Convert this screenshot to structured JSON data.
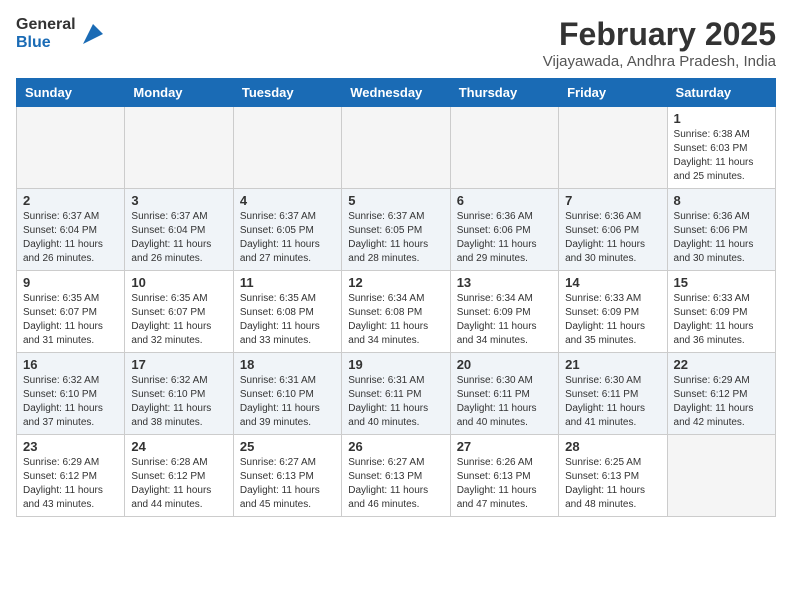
{
  "header": {
    "logo_general": "General",
    "logo_blue": "Blue",
    "month_year": "February 2025",
    "location": "Vijayawada, Andhra Pradesh, India"
  },
  "weekdays": [
    "Sunday",
    "Monday",
    "Tuesday",
    "Wednesday",
    "Thursday",
    "Friday",
    "Saturday"
  ],
  "weeks": [
    [
      {
        "day": "",
        "info": ""
      },
      {
        "day": "",
        "info": ""
      },
      {
        "day": "",
        "info": ""
      },
      {
        "day": "",
        "info": ""
      },
      {
        "day": "",
        "info": ""
      },
      {
        "day": "",
        "info": ""
      },
      {
        "day": "1",
        "info": "Sunrise: 6:38 AM\nSunset: 6:03 PM\nDaylight: 11 hours\nand 25 minutes."
      }
    ],
    [
      {
        "day": "2",
        "info": "Sunrise: 6:37 AM\nSunset: 6:04 PM\nDaylight: 11 hours\nand 26 minutes."
      },
      {
        "day": "3",
        "info": "Sunrise: 6:37 AM\nSunset: 6:04 PM\nDaylight: 11 hours\nand 26 minutes."
      },
      {
        "day": "4",
        "info": "Sunrise: 6:37 AM\nSunset: 6:05 PM\nDaylight: 11 hours\nand 27 minutes."
      },
      {
        "day": "5",
        "info": "Sunrise: 6:37 AM\nSunset: 6:05 PM\nDaylight: 11 hours\nand 28 minutes."
      },
      {
        "day": "6",
        "info": "Sunrise: 6:36 AM\nSunset: 6:06 PM\nDaylight: 11 hours\nand 29 minutes."
      },
      {
        "day": "7",
        "info": "Sunrise: 6:36 AM\nSunset: 6:06 PM\nDaylight: 11 hours\nand 30 minutes."
      },
      {
        "day": "8",
        "info": "Sunrise: 6:36 AM\nSunset: 6:06 PM\nDaylight: 11 hours\nand 30 minutes."
      }
    ],
    [
      {
        "day": "9",
        "info": "Sunrise: 6:35 AM\nSunset: 6:07 PM\nDaylight: 11 hours\nand 31 minutes."
      },
      {
        "day": "10",
        "info": "Sunrise: 6:35 AM\nSunset: 6:07 PM\nDaylight: 11 hours\nand 32 minutes."
      },
      {
        "day": "11",
        "info": "Sunrise: 6:35 AM\nSunset: 6:08 PM\nDaylight: 11 hours\nand 33 minutes."
      },
      {
        "day": "12",
        "info": "Sunrise: 6:34 AM\nSunset: 6:08 PM\nDaylight: 11 hours\nand 34 minutes."
      },
      {
        "day": "13",
        "info": "Sunrise: 6:34 AM\nSunset: 6:09 PM\nDaylight: 11 hours\nand 34 minutes."
      },
      {
        "day": "14",
        "info": "Sunrise: 6:33 AM\nSunset: 6:09 PM\nDaylight: 11 hours\nand 35 minutes."
      },
      {
        "day": "15",
        "info": "Sunrise: 6:33 AM\nSunset: 6:09 PM\nDaylight: 11 hours\nand 36 minutes."
      }
    ],
    [
      {
        "day": "16",
        "info": "Sunrise: 6:32 AM\nSunset: 6:10 PM\nDaylight: 11 hours\nand 37 minutes."
      },
      {
        "day": "17",
        "info": "Sunrise: 6:32 AM\nSunset: 6:10 PM\nDaylight: 11 hours\nand 38 minutes."
      },
      {
        "day": "18",
        "info": "Sunrise: 6:31 AM\nSunset: 6:10 PM\nDaylight: 11 hours\nand 39 minutes."
      },
      {
        "day": "19",
        "info": "Sunrise: 6:31 AM\nSunset: 6:11 PM\nDaylight: 11 hours\nand 40 minutes."
      },
      {
        "day": "20",
        "info": "Sunrise: 6:30 AM\nSunset: 6:11 PM\nDaylight: 11 hours\nand 40 minutes."
      },
      {
        "day": "21",
        "info": "Sunrise: 6:30 AM\nSunset: 6:11 PM\nDaylight: 11 hours\nand 41 minutes."
      },
      {
        "day": "22",
        "info": "Sunrise: 6:29 AM\nSunset: 6:12 PM\nDaylight: 11 hours\nand 42 minutes."
      }
    ],
    [
      {
        "day": "23",
        "info": "Sunrise: 6:29 AM\nSunset: 6:12 PM\nDaylight: 11 hours\nand 43 minutes."
      },
      {
        "day": "24",
        "info": "Sunrise: 6:28 AM\nSunset: 6:12 PM\nDaylight: 11 hours\nand 44 minutes."
      },
      {
        "day": "25",
        "info": "Sunrise: 6:27 AM\nSunset: 6:13 PM\nDaylight: 11 hours\nand 45 minutes."
      },
      {
        "day": "26",
        "info": "Sunrise: 6:27 AM\nSunset: 6:13 PM\nDaylight: 11 hours\nand 46 minutes."
      },
      {
        "day": "27",
        "info": "Sunrise: 6:26 AM\nSunset: 6:13 PM\nDaylight: 11 hours\nand 47 minutes."
      },
      {
        "day": "28",
        "info": "Sunrise: 6:25 AM\nSunset: 6:13 PM\nDaylight: 11 hours\nand 48 minutes."
      },
      {
        "day": "",
        "info": ""
      }
    ]
  ]
}
